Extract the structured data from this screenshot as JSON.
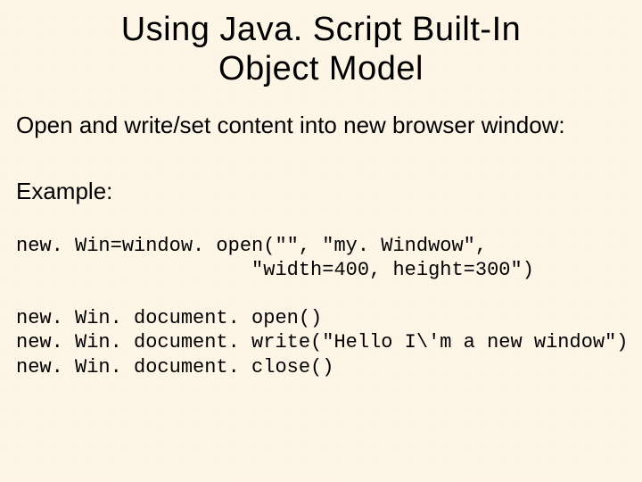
{
  "title_line1": "Using Java. Script Built-In",
  "title_line2": "Object Model",
  "subtitle": "Open and write/set content into new browser window:",
  "example_label": "Example:",
  "code1_line1": "new. Win=window. open(\"\", \"my. Windwow\",",
  "code1_line2": "                    \"width=400, height=300\")",
  "code2_line1": "new. Win. document. open()",
  "code2_line2": "new. Win. document. write(\"Hello I\\'m a new window\")",
  "code2_line3": "new. Win. document. close()"
}
